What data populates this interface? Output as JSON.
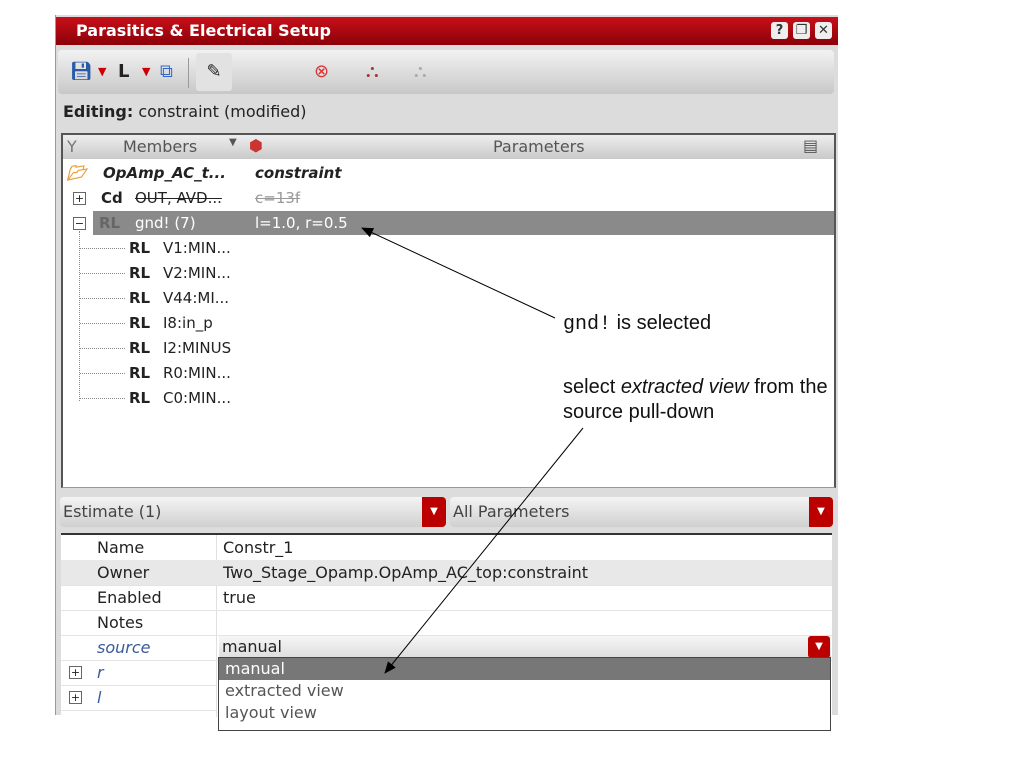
{
  "window": {
    "title": "Parasitics & Electrical Setup",
    "buttons": [
      "?",
      "❐",
      "✕"
    ]
  },
  "toolbar": {
    "icons": [
      "save-icon",
      "dropdown-icon",
      "L",
      "dropdown-icon",
      "compare-icon",
      "edit-icon",
      "delete-icon",
      "probe-icon",
      "probe-disabled-icon"
    ],
    "l_label": "L"
  },
  "editing": {
    "label": "Editing:",
    "value": "constraint (modified)"
  },
  "tree": {
    "headers": {
      "members": "Members",
      "parameters": "Parameters"
    },
    "rows": [
      {
        "icon": "",
        "member": "OpAmp_AC_t...",
        "params": "constraint"
      },
      {
        "icon": "Cd",
        "member": "OUT, AVD...",
        "params": "c=13f"
      },
      {
        "icon": "RL",
        "member": "gnd! (7)",
        "params": "l=1.0, r=0.5"
      },
      {
        "icon": "RL",
        "member": "V1:MIN..."
      },
      {
        "icon": "RL",
        "member": "V2:MIN..."
      },
      {
        "icon": "RL",
        "member": "V44:MI..."
      },
      {
        "icon": "RL",
        "member": "I8:in_p"
      },
      {
        "icon": "RL",
        "member": "I2:MINUS"
      },
      {
        "icon": "RL",
        "member": "R0:MIN..."
      },
      {
        "icon": "RL",
        "member": "C0:MIN..."
      }
    ]
  },
  "filters": {
    "left": "Estimate (1)",
    "right": "All Parameters"
  },
  "props": [
    {
      "key": "Name",
      "value": "Constr_1"
    },
    {
      "key": "Owner",
      "value": "Two_Stage_Opamp.OpAmp_AC_top:constraint"
    },
    {
      "key": "Enabled",
      "value": "true"
    },
    {
      "key": "Notes",
      "value": ""
    },
    {
      "key": "source",
      "value": "manual"
    },
    {
      "key": "r"
    },
    {
      "key": "l"
    }
  ],
  "source_options": [
    "manual",
    "extracted view",
    "layout view"
  ],
  "annotations": {
    "a1_code": "gnd!",
    "a1_text": " is selected",
    "a2_pre": "select ",
    "a2_em": "extracted view",
    "a2_post": " from the",
    "a2_line2": "source pull-down"
  }
}
